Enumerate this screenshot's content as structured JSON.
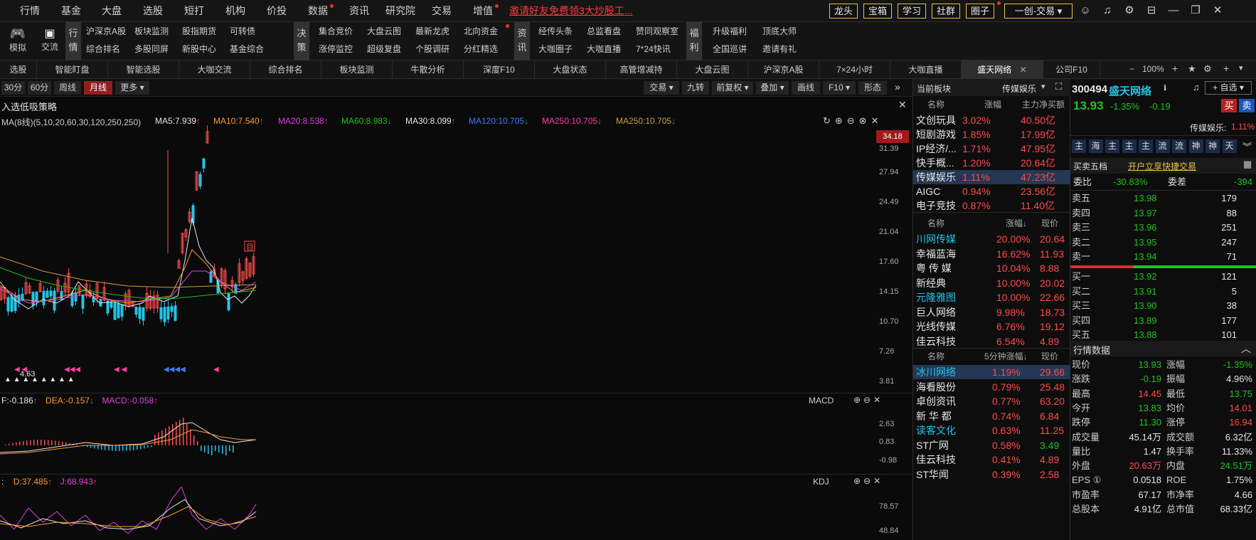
{
  "topbar": {
    "menus": [
      "行情",
      "基金",
      "大盘",
      "选股",
      "短打",
      "机构",
      "价投",
      "数据",
      "资讯",
      "研究院",
      "交易",
      "增值"
    ],
    "invite": "邀请好友免费领3大炒股工...",
    "tools": [
      "龙头",
      "宝箱",
      "学习",
      "社群",
      "圈子"
    ],
    "account": "一创-交易",
    "window_icons": [
      "user-icon",
      "bell-icon",
      "gear-icon",
      "minimize-icon",
      "restore-icon",
      "close-icon"
    ]
  },
  "bar2": {
    "left_buttons": [
      "模拟",
      "交流"
    ],
    "groups": [
      {
        "tab": "行情",
        "items": [
          [
            "沪深京A股",
            "板块监测",
            "股指期货",
            "可转债"
          ],
          [
            "综合排名",
            "多股同屏",
            "新股中心",
            "基金综合"
          ]
        ]
      },
      {
        "tab": "决策",
        "items": [
          [
            "集合竞价",
            "大盘云图",
            "最新龙虎",
            "北向资金"
          ],
          [
            "涨停监控",
            "超级复盘",
            "个股调研",
            "分红精选"
          ]
        ]
      },
      {
        "tab": "资讯",
        "items": [
          [
            "经传头条",
            "总监看盘",
            "赞同观察室"
          ],
          [
            "大咖圈子",
            "大咖直播",
            "7*24快讯"
          ]
        ]
      },
      {
        "tab": "福利",
        "items": [
          [
            "升级福利",
            "顶底大师"
          ],
          [
            "全国巡讲",
            "邀请有礼"
          ]
        ]
      }
    ]
  },
  "tabs": [
    "选股",
    "智能盯盘",
    "智能选股",
    "大咖交流",
    "综合排名",
    "板块监测",
    "牛散分析",
    "深度F10",
    "大盘状态",
    "高管增减持",
    "大盘云图",
    "沪深京A股",
    "7×24小时",
    "大咖直播",
    "盛天网络",
    "公司F10"
  ],
  "tabs_right": {
    "zoom": "100%"
  },
  "period_bar": {
    "buttons": [
      "30分",
      "60分",
      "周线",
      "月线",
      "更多"
    ],
    "active": "月线",
    "right_buttons": [
      "交易",
      "九转",
      "前复权",
      "叠加",
      "画线",
      "F10",
      "形态"
    ]
  },
  "chart": {
    "strategy_title": "入选低吸策略",
    "ma_header": "MA(8线)(5,10,20,60,30,120,250,250)",
    "ma_items": [
      {
        "label": "MA5:7.939",
        "arrow": "↑",
        "color": "#e6e6e6"
      },
      {
        "label": "MA10:7.540",
        "arrow": "↑",
        "color": "#ff9a2e"
      },
      {
        "label": "MA20:8.538",
        "arrow": "↑",
        "color": "#e040e0"
      },
      {
        "label": "MA60:8.983",
        "arrow": "↓",
        "color": "#1ec31e"
      },
      {
        "label": "MA30:8.099",
        "arrow": "↑",
        "color": "#e6e6e6"
      },
      {
        "label": "MA120:10.705",
        "arrow": "↓",
        "color": "#3b7bff"
      },
      {
        "label": "MA250:10.705",
        "arrow": "↓",
        "color": "#ff3fa0"
      },
      {
        "label": "MA250:10.705",
        "arrow": "↓",
        "color": "#c8a040"
      }
    ],
    "price_axis": [
      "34.18",
      "31.39",
      "27.94",
      "24.49",
      "21.04",
      "17.60",
      "14.15",
      "10.70",
      "7.26",
      "3.81"
    ],
    "low_label": "4.63",
    "macd_line": {
      "dif": "-0.186",
      "dea": "-0.157",
      "macd": "-0.058",
      "name": "MACD"
    },
    "macd_axis": [
      "2.63",
      "0.83",
      "-0.98"
    ],
    "kdj_line": {
      "d": "D:37.485",
      "j": "J:68.943",
      "name": "KDJ"
    },
    "kdj_axis": [
      "78.57",
      "48.84"
    ],
    "flag": "目"
  },
  "sector": {
    "title": "当前板块",
    "current": "传媒娱乐",
    "headers": [
      "名称",
      "涨幅",
      "主力净买额"
    ],
    "rows": [
      [
        "文创玩具",
        "3.02%",
        "40.50亿"
      ],
      [
        "短剧游戏",
        "1.85%",
        "17.99亿"
      ],
      [
        "IP经济/...",
        "1.71%",
        "47.95亿"
      ],
      [
        "快手概...",
        "1.20%",
        "20.64亿"
      ],
      [
        "传媒娱乐",
        "1.11%",
        "47.23亿"
      ],
      [
        "AIGC",
        "0.94%",
        "23.56亿"
      ],
      [
        "电子竞技",
        "0.87%",
        "11.40亿"
      ]
    ]
  },
  "rank1": {
    "headers": [
      "名称",
      "涨幅↓",
      "现价"
    ],
    "rows": [
      [
        "川网传媒",
        "20.00%",
        "20.64"
      ],
      [
        "幸福蓝海",
        "16.62%",
        "11.93"
      ],
      [
        "粤 传 媒",
        "10.04%",
        "8.88"
      ],
      [
        "新经典",
        "10.00%",
        "20.02"
      ],
      [
        "元隆雅图",
        "10.00%",
        "22.66"
      ],
      [
        "巨人网络",
        "9.98%",
        "18.73"
      ],
      [
        "光线传媒",
        "6.76%",
        "19.12"
      ],
      [
        "佳云科技",
        "6.54%",
        "4.89"
      ]
    ]
  },
  "rank2": {
    "headers": [
      "名称",
      "5分钟涨幅↓",
      "现价"
    ],
    "rows": [
      [
        "冰川网络",
        "1.19%",
        "29.66"
      ],
      [
        "海看股份",
        "0.79%",
        "25.48"
      ],
      [
        "卓创资讯",
        "0.77%",
        "63.20"
      ],
      [
        "新 华 都",
        "0.74%",
        "6.84"
      ],
      [
        "读客文化",
        "0.63%",
        "11.25"
      ],
      [
        "ST广网",
        "0.58%",
        "3.49"
      ],
      [
        "佳云科技",
        "0.41%",
        "4.89"
      ],
      [
        "ST华闻",
        "0.39%",
        "2.58"
      ]
    ]
  },
  "stock": {
    "code": "300494",
    "name": "盛天网络",
    "price": "13.93",
    "change_pct": "-1.35%",
    "change": "-0.19",
    "fav": "自选",
    "buy": "买",
    "sell": "卖",
    "sector_tag": "传媒娱乐:",
    "sector_pct": "1.11%",
    "tags": [
      "主",
      "海",
      "主",
      "主",
      "主",
      "流",
      "流",
      "神",
      "神",
      "天"
    ],
    "five_title": "买卖五档",
    "quick_trade": "开户立享快捷交易",
    "weibi": {
      "label": "委比",
      "value": "-30.83%",
      "diff_label": "委差",
      "diff": "-394"
    },
    "asks": [
      [
        "卖五",
        "13.98",
        "179"
      ],
      [
        "卖四",
        "13.97",
        "88"
      ],
      [
        "卖三",
        "13.96",
        "251"
      ],
      [
        "卖二",
        "13.95",
        "247"
      ],
      [
        "卖一",
        "13.94",
        "71"
      ]
    ],
    "bids": [
      [
        "买一",
        "13.92",
        "121"
      ],
      [
        "买二",
        "13.91",
        "5"
      ],
      [
        "买三",
        "13.90",
        "38"
      ],
      [
        "买四",
        "13.89",
        "177"
      ],
      [
        "买五",
        "13.88",
        "101"
      ]
    ],
    "quote_title": "行情数据",
    "quote": [
      [
        "现价",
        "13.93",
        "涨幅",
        "-1.35%"
      ],
      [
        "涨跌",
        "-0.19",
        "振幅",
        "4.96%"
      ],
      [
        "最高",
        "14.45",
        "最低",
        "13.75"
      ],
      [
        "今开",
        "13.83",
        "均价",
        "14.01"
      ],
      [
        "跌停",
        "11.30",
        "涨停",
        "16.94"
      ],
      [
        "成交量",
        "45.14万",
        "成交额",
        "6.32亿"
      ],
      [
        "量比",
        "1.47",
        "换手率",
        "11.33%"
      ],
      [
        "外盘",
        "20.63万",
        "内盘",
        "24.51万"
      ],
      [
        "EPS ①",
        "0.0518",
        "ROE",
        "1.75%"
      ],
      [
        "市盈率",
        "67.17",
        "市净率",
        "4.66"
      ],
      [
        "总股本",
        "4.91亿",
        "总市值",
        "68.33亿"
      ]
    ]
  },
  "colors": {
    "up": "#ff4b4b",
    "down": "#1ec31e",
    "accent": "#e8c34b",
    "highlight": "#23c4e6"
  }
}
